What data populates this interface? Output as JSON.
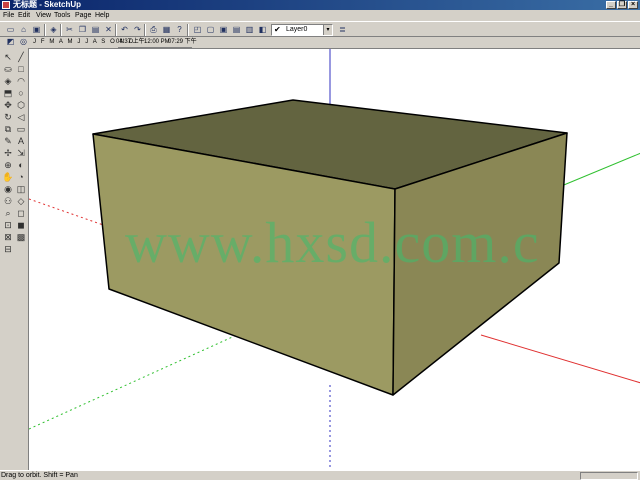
{
  "window": {
    "title": "无标题 - SketchUp",
    "minimize_glyph": "_",
    "maximize_glyph": "❐",
    "close_glyph": "×"
  },
  "menu": [
    {
      "label": "File"
    },
    {
      "label": "Edit"
    },
    {
      "label": "View"
    },
    {
      "label": "Tools"
    },
    {
      "label": "Page"
    },
    {
      "label": "Help"
    }
  ],
  "toolbar": {
    "layer_name": "Layer0",
    "layer_check": "✔",
    "layer_arrow": "▾"
  },
  "shadow": {
    "months": "J F M A M J J A S O N D",
    "time_start": "04:37 上午",
    "time_noon": "12:00 PM",
    "time_end": "07:29 下午"
  },
  "viewport": {
    "watermark": "www.hxsd.com.c",
    "colors": {
      "box_top": "#636440",
      "box_front": "#9c9a62",
      "box_side": "#8a8755",
      "axis_red": "#e03030",
      "axis_green": "#30c030",
      "axis_blue": "#3030c0"
    }
  },
  "status": {
    "text": "Drag to orbit.  Shift = Pan"
  }
}
